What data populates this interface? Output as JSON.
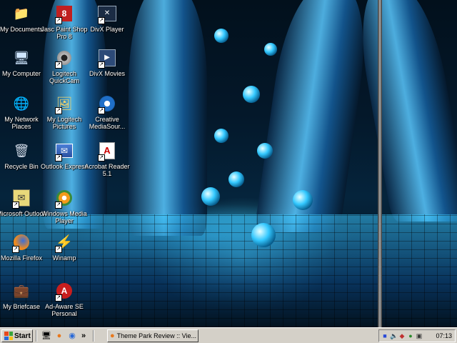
{
  "desktop": {
    "icons": [
      {
        "label": "My Documents",
        "icon": "folder-documents-icon"
      },
      {
        "label": "Jasc Paint Shop Pro 8",
        "icon": "paint-shop-pro-icon"
      },
      {
        "label": "DivX Player",
        "icon": "divx-player-icon"
      },
      {
        "label": "My Computer",
        "icon": "computer-icon"
      },
      {
        "label": "Logitech QuickCam",
        "icon": "webcam-icon"
      },
      {
        "label": "DivX Movies",
        "icon": "divx-movies-icon"
      },
      {
        "label": "My Network Places",
        "icon": "network-places-icon"
      },
      {
        "label": "My Logitech Pictures",
        "icon": "pictures-folder-icon"
      },
      {
        "label": "Creative MediaSour...",
        "icon": "creative-mediasource-icon"
      },
      {
        "label": "Recycle Bin",
        "icon": "recycle-bin-icon"
      },
      {
        "label": "Outlook Express",
        "icon": "outlook-express-icon"
      },
      {
        "label": "Acrobat Reader 5.1",
        "icon": "acrobat-reader-icon"
      },
      {
        "label": "Microsoft Outlook",
        "icon": "outlook-icon"
      },
      {
        "label": "Windows Media Player",
        "icon": "media-player-icon"
      },
      {
        "label": "Mozilla Firefox",
        "icon": "firefox-icon"
      },
      {
        "label": "Winamp",
        "icon": "winamp-icon"
      },
      {
        "label": "My Briefcase",
        "icon": "briefcase-icon"
      },
      {
        "label": "Ad-Aware SE Personal",
        "icon": "ad-aware-icon"
      }
    ]
  },
  "taskbar": {
    "start_label": "Start",
    "quick_launch": [
      "show-desktop-icon",
      "firefox-icon",
      "browser-icon"
    ],
    "overflow_label": "»",
    "task_button_label": "Theme Park Review :: Vie...",
    "clock": "07:13",
    "tray_icons": [
      "network-icon",
      "volume-icon",
      "security-icon",
      "messenger-icon",
      "monitor-icon"
    ]
  },
  "colors": {
    "taskbar": "#d4d0c8",
    "wallpaper_accent": "#33c8ff"
  }
}
